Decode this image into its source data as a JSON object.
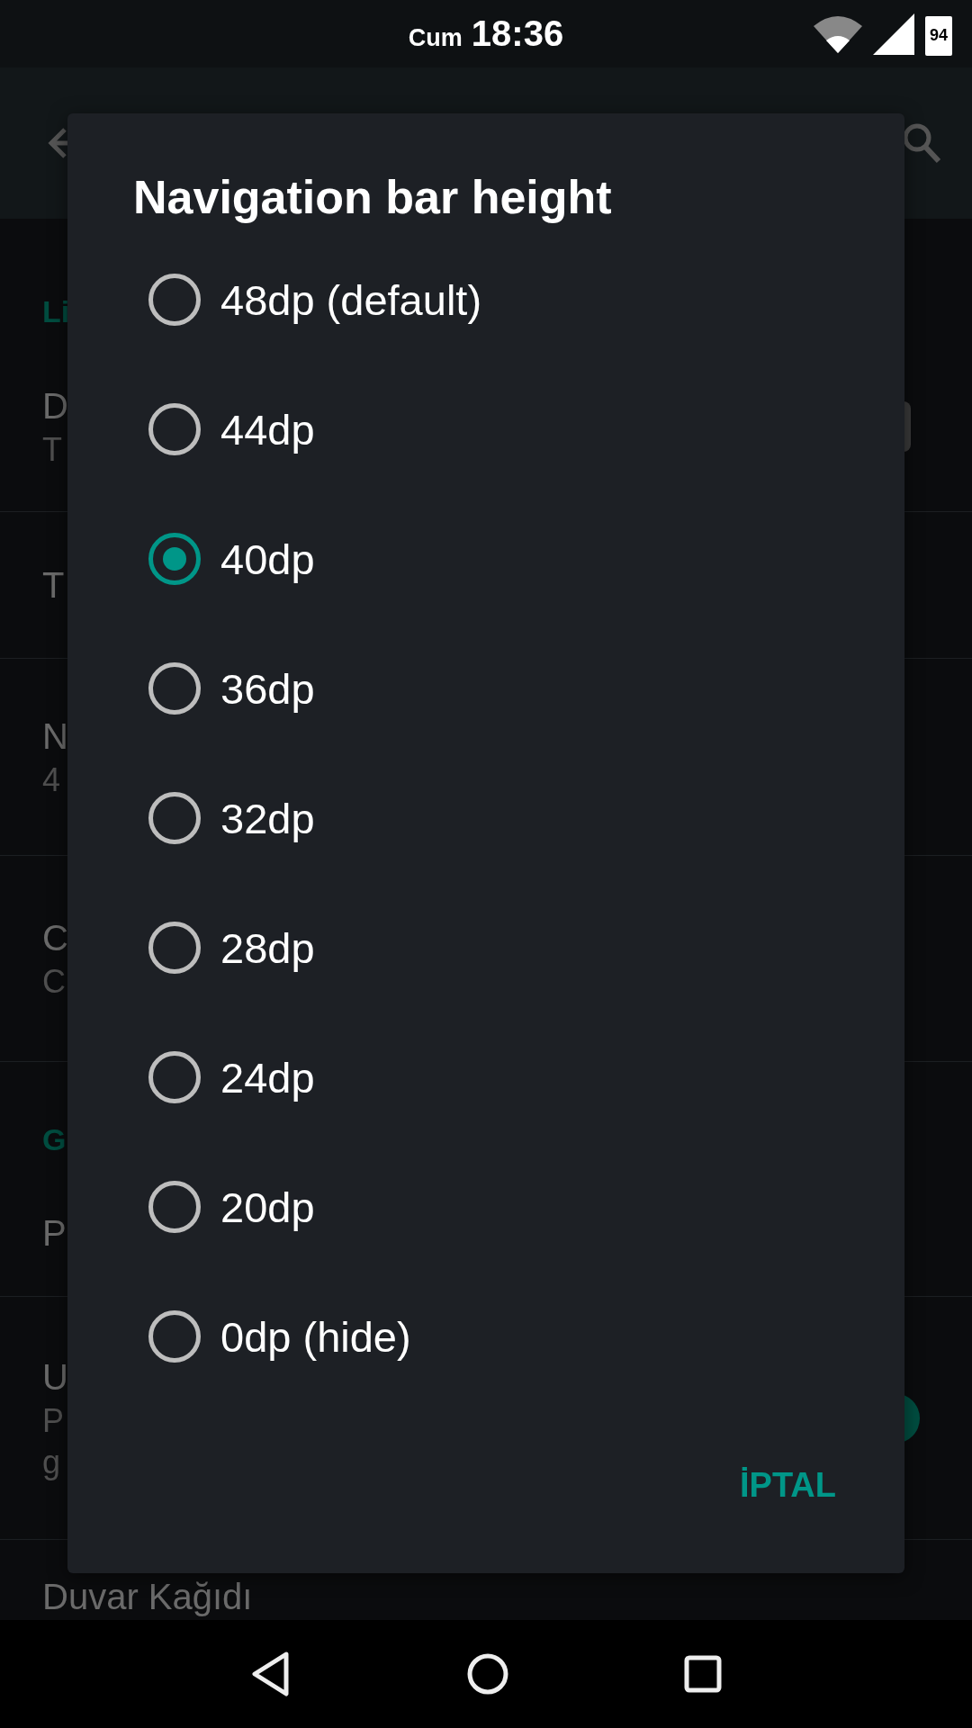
{
  "status_bar": {
    "day": "Cum",
    "time": "18:36",
    "battery": "94"
  },
  "background": [
    {
      "kind": "header",
      "title": "Li"
    },
    {
      "kind": "row",
      "title": "D",
      "subtitle": "T",
      "switch_on": false
    },
    {
      "kind": "row",
      "title": "T"
    },
    {
      "kind": "row",
      "title": "N",
      "subtitle": "4"
    },
    {
      "kind": "row",
      "title": "C",
      "subtitle": "C"
    },
    {
      "kind": "header",
      "title": "G"
    },
    {
      "kind": "row",
      "title": "P"
    },
    {
      "kind": "row",
      "title": "U",
      "subtitle": "P",
      "subtitle_2": "g",
      "switch_on": true
    },
    {
      "kind": "row",
      "title": "Duvar Kağıdı"
    }
  ],
  "dialog": {
    "title": "Navigation bar height",
    "options": [
      {
        "label": "48dp (default)",
        "selected": false
      },
      {
        "label": "44dp",
        "selected": false
      },
      {
        "label": "40dp",
        "selected": true
      },
      {
        "label": "36dp",
        "selected": false
      },
      {
        "label": "32dp",
        "selected": false
      },
      {
        "label": "28dp",
        "selected": false
      },
      {
        "label": "24dp",
        "selected": false
      },
      {
        "label": "20dp",
        "selected": false
      },
      {
        "label": "0dp (hide)",
        "selected": false
      }
    ],
    "cancel": "İPTAL"
  }
}
